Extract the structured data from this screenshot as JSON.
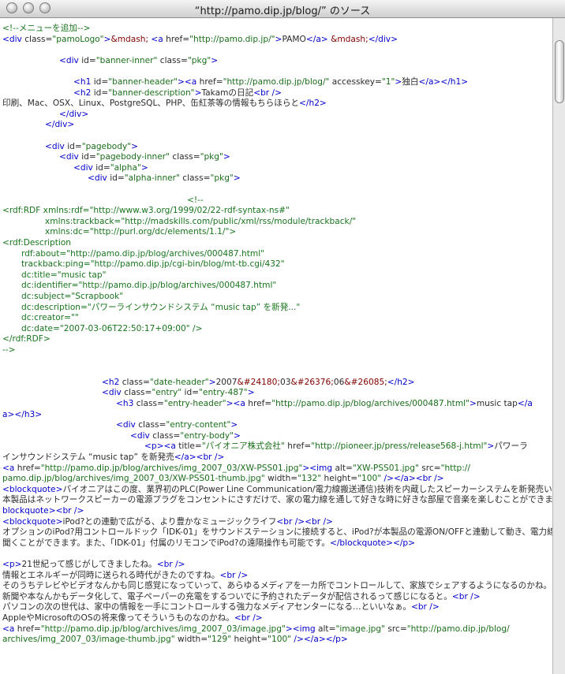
{
  "window": {
    "title": "“http://pamo.dip.jp/blog/” のソース"
  },
  "source": [
    {
      "indent": 0,
      "segs": [
        [
          "cmt",
          "<!--メニューを追加-->"
        ]
      ]
    },
    {
      "indent": 0,
      "segs": [
        [
          "tag",
          "<div "
        ],
        [
          "attr",
          "class="
        ],
        [
          "val",
          "\"pamoLogo\""
        ],
        [
          "tag",
          ">"
        ],
        [
          "ent",
          "&mdash;"
        ],
        [
          "attr",
          " "
        ],
        [
          "tag",
          "<a "
        ],
        [
          "attr",
          "href="
        ],
        [
          "val",
          "\"http://pamo.dip.jp/\""
        ],
        [
          "tag",
          ">"
        ],
        [
          "attr",
          "PAMO"
        ],
        [
          "tag",
          "</a>"
        ],
        [
          "attr",
          " "
        ],
        [
          "ent",
          "&mdash;"
        ],
        [
          "tag",
          "</div>"
        ]
      ]
    },
    {
      "indent": 0,
      "segs": []
    },
    {
      "indent": 72,
      "segs": [
        [
          "tag",
          "<div "
        ],
        [
          "attr",
          "id="
        ],
        [
          "val",
          "\"banner-inner\""
        ],
        [
          "attr",
          " class="
        ],
        [
          "val",
          "\"pkg\""
        ],
        [
          "tag",
          ">"
        ]
      ]
    },
    {
      "indent": 0,
      "segs": []
    },
    {
      "indent": 90,
      "segs": [
        [
          "tag",
          "<h1 "
        ],
        [
          "attr",
          "id="
        ],
        [
          "val",
          "\"banner-header\""
        ],
        [
          "tag",
          "><a "
        ],
        [
          "attr",
          "href="
        ],
        [
          "val",
          "\"http://pamo.dip.jp/blog/\""
        ],
        [
          "attr",
          " accesskey="
        ],
        [
          "val",
          "\"1\""
        ],
        [
          "tag",
          ">"
        ],
        [
          "attr",
          "独白"
        ],
        [
          "tag",
          "</a></h1>"
        ]
      ]
    },
    {
      "indent": 90,
      "segs": [
        [
          "tag",
          "<h2 "
        ],
        [
          "attr",
          "id="
        ],
        [
          "val",
          "\"banner-description\""
        ],
        [
          "tag",
          ">"
        ],
        [
          "attr",
          "Takamの日記"
        ],
        [
          "tag",
          "<br />"
        ]
      ]
    },
    {
      "indent": 0,
      "segs": [
        [
          "attr",
          "印刷、Mac、OSX、Linux、PostgreSQL、PHP、缶紅茶等の情報もちらほらと"
        ],
        [
          "tag",
          "</h2>"
        ]
      ]
    },
    {
      "indent": 72,
      "segs": [
        [
          "tag",
          "</div>"
        ]
      ]
    },
    {
      "indent": 54,
      "segs": [
        [
          "tag",
          "</div>"
        ]
      ]
    },
    {
      "indent": 0,
      "segs": []
    },
    {
      "indent": 54,
      "segs": [
        [
          "tag",
          "<div "
        ],
        [
          "attr",
          "id="
        ],
        [
          "val",
          "\"pagebody\""
        ],
        [
          "tag",
          ">"
        ]
      ]
    },
    {
      "indent": 72,
      "segs": [
        [
          "tag",
          "<div "
        ],
        [
          "attr",
          "id="
        ],
        [
          "val",
          "\"pagebody-inner\""
        ],
        [
          "attr",
          " class="
        ],
        [
          "val",
          "\"pkg\""
        ],
        [
          "tag",
          ">"
        ]
      ]
    },
    {
      "indent": 90,
      "segs": [
        [
          "tag",
          "<div "
        ],
        [
          "attr",
          "id="
        ],
        [
          "val",
          "\"alpha\""
        ],
        [
          "tag",
          ">"
        ]
      ]
    },
    {
      "indent": 108,
      "segs": [
        [
          "tag",
          "<div "
        ],
        [
          "attr",
          "id="
        ],
        [
          "val",
          "\"alpha-inner\""
        ],
        [
          "attr",
          " class="
        ],
        [
          "val",
          "\"pkg\""
        ],
        [
          "tag",
          ">"
        ]
      ]
    },
    {
      "indent": 0,
      "segs": []
    },
    {
      "indent": 234,
      "segs": [
        [
          "cmt",
          "<!--"
        ]
      ]
    },
    {
      "indent": 0,
      "segs": [
        [
          "cmt",
          "<rdf:RDF xmlns:rdf=\"http://www.w3.org/1999/02/22-rdf-syntax-ns#\""
        ]
      ]
    },
    {
      "indent": 54,
      "segs": [
        [
          "cmt",
          "xmlns:trackback=\"http://madskills.com/public/xml/rss/module/trackback/\""
        ]
      ]
    },
    {
      "indent": 54,
      "segs": [
        [
          "cmt",
          "xmlns:dc=\"http://purl.org/dc/elements/1.1/\">"
        ]
      ]
    },
    {
      "indent": 0,
      "segs": [
        [
          "cmt",
          "<rdf:Description"
        ]
      ]
    },
    {
      "indent": 24,
      "segs": [
        [
          "cmt",
          "rdf:about=\"http://pamo.dip.jp/blog/archives/000487.html\""
        ]
      ]
    },
    {
      "indent": 24,
      "segs": [
        [
          "cmt",
          "trackback:ping=\"http://pamo.dip.jp/cgi-bin/blog/mt-tb.cgi/432\""
        ]
      ]
    },
    {
      "indent": 24,
      "segs": [
        [
          "cmt",
          "dc:title=\"music tap\""
        ]
      ]
    },
    {
      "indent": 24,
      "segs": [
        [
          "cmt",
          "dc:identifier=\"http://pamo.dip.jp/blog/archives/000487.html\""
        ]
      ]
    },
    {
      "indent": 24,
      "segs": [
        [
          "cmt",
          "dc:subject=\"Scrapbook\""
        ]
      ]
    },
    {
      "indent": 24,
      "segs": [
        [
          "cmt",
          "dc:description=\"パワーラインサウンドシステム “music tap” を新発...\""
        ]
      ]
    },
    {
      "indent": 24,
      "segs": [
        [
          "cmt",
          "dc:creator=\"\""
        ]
      ]
    },
    {
      "indent": 24,
      "segs": [
        [
          "cmt",
          "dc:date=\"2007-03-06T22:50:17+09:00\" />"
        ]
      ]
    },
    {
      "indent": 0,
      "segs": [
        [
          "cmt",
          "</rdf:RDF>"
        ]
      ]
    },
    {
      "indent": 0,
      "segs": [
        [
          "cmt",
          "-->"
        ]
      ]
    },
    {
      "indent": 0,
      "segs": []
    },
    {
      "indent": 0,
      "segs": []
    },
    {
      "indent": 126,
      "segs": [
        [
          "tag",
          "<h2 "
        ],
        [
          "attr",
          "class="
        ],
        [
          "val",
          "\"date-header\""
        ],
        [
          "tag",
          ">"
        ],
        [
          "attr",
          "2007"
        ],
        [
          "ent",
          "&#24180;"
        ],
        [
          "attr",
          "03"
        ],
        [
          "ent",
          "&#26376;"
        ],
        [
          "attr",
          "06"
        ],
        [
          "ent",
          "&#26085;"
        ],
        [
          "tag",
          "</h2>"
        ]
      ]
    },
    {
      "indent": 126,
      "segs": [
        [
          "tag",
          "<div "
        ],
        [
          "attr",
          "class="
        ],
        [
          "val",
          "\"entry\""
        ],
        [
          "attr",
          " id="
        ],
        [
          "val",
          "\"entry-487\""
        ],
        [
          "tag",
          ">"
        ]
      ]
    },
    {
      "indent": 144,
      "segs": [
        [
          "tag",
          "<h3 "
        ],
        [
          "attr",
          "class="
        ],
        [
          "val",
          "\"entry-header\""
        ],
        [
          "tag",
          "><a "
        ],
        [
          "attr",
          "href="
        ],
        [
          "val",
          "\"http://pamo.dip.jp/blog/archives/000487.html\""
        ],
        [
          "tag",
          ">"
        ],
        [
          "attr",
          "music tap"
        ],
        [
          "tag",
          "</a"
        ]
      ]
    },
    {
      "indent": 0,
      "segs": [
        [
          "tag",
          "a></h3>"
        ]
      ]
    },
    {
      "indent": 144,
      "segs": [
        [
          "tag",
          "<div "
        ],
        [
          "attr",
          "class="
        ],
        [
          "val",
          "\"entry-content\""
        ],
        [
          "tag",
          ">"
        ]
      ]
    },
    {
      "indent": 162,
      "segs": [
        [
          "tag",
          "<div "
        ],
        [
          "attr",
          "class="
        ],
        [
          "val",
          "\"entry-body\""
        ],
        [
          "tag",
          ">"
        ]
      ]
    },
    {
      "indent": 180,
      "segs": [
        [
          "tag",
          "<p><a "
        ],
        [
          "attr",
          "title="
        ],
        [
          "val",
          "\"パイオニア株式会社\""
        ],
        [
          "attr",
          " href="
        ],
        [
          "val",
          "\"http://pioneer.jp/press/release568-j.html\""
        ],
        [
          "tag",
          ">"
        ],
        [
          "attr",
          "パワーラ"
        ]
      ]
    },
    {
      "indent": 0,
      "segs": [
        [
          "attr",
          "インサウンドシステム “music tap” を新発売"
        ],
        [
          "tag",
          "</a><br />"
        ]
      ]
    },
    {
      "indent": 0,
      "segs": [
        [
          "tag",
          "<a "
        ],
        [
          "attr",
          "href="
        ],
        [
          "val",
          "\"http://pamo.dip.jp/blog/archives/img_2007_03/XW-PSS01.jpg\""
        ],
        [
          "tag",
          "><img "
        ],
        [
          "attr",
          "alt="
        ],
        [
          "val",
          "\"XW-PSS01.jpg\""
        ],
        [
          "attr",
          " src="
        ],
        [
          "val",
          "\"http://"
        ]
      ]
    },
    {
      "indent": 0,
      "segs": [
        [
          "val",
          "pamo.dip.jp/blog/archives/img_2007_03/XW-PSS01-thumb.jpg\""
        ],
        [
          "attr",
          " width="
        ],
        [
          "val",
          "\"132\""
        ],
        [
          "attr",
          " height="
        ],
        [
          "val",
          "\"100\""
        ],
        [
          "tag",
          " /></a><br />"
        ]
      ]
    },
    {
      "indent": 0,
      "segs": [
        [
          "tag",
          "<blockquote>"
        ],
        [
          "attr",
          "パイオニアはこの度、業界初のPLC(Power Line Communication/電力線搬送通信)技術を内蔵したスピーカーシステムを新発売いたします。"
        ]
      ]
    },
    {
      "indent": 0,
      "segs": [
        [
          "attr",
          "本製品はネットワークスピーカーの電源プラグをコンセントにさすだけで、家の電力線を通して好きな時に好きな部屋で音楽を楽しむことができます。"
        ],
        [
          "tag",
          "</"
        ]
      ]
    },
    {
      "indent": 0,
      "segs": [
        [
          "tag",
          "blockquote><br />"
        ]
      ]
    },
    {
      "indent": 0,
      "segs": [
        [
          "tag",
          "<blockquote>"
        ],
        [
          "attr",
          "iPod?との連動で広がる、より豊かなミュージックライフ"
        ],
        [
          "tag",
          "<br /><br />"
        ]
      ]
    },
    {
      "indent": 0,
      "segs": [
        [
          "attr",
          "オプションのiPod?用コントロールドック「IDK-01」をサウンドステーションに接続すると、iPod?が本製品の電源ON/OFFと連動して動き、電力線を介して家中どこでも"
        ]
      ]
    },
    {
      "indent": 0,
      "segs": [
        [
          "attr",
          "聞くことができます。また、「IDK-01」付属のリモコンでiPod?の遠隔操作も可能です。"
        ],
        [
          "tag",
          "</blockquote></p>"
        ]
      ]
    },
    {
      "indent": 0,
      "segs": []
    },
    {
      "indent": 0,
      "segs": [
        [
          "tag",
          "<p>"
        ],
        [
          "attr",
          "21世紀って感じがしてきましたね。"
        ],
        [
          "tag",
          "<br />"
        ]
      ]
    },
    {
      "indent": 0,
      "segs": [
        [
          "attr",
          "情報とエネルギーが同時に送られる時代がきたのですね。"
        ],
        [
          "tag",
          "<br />"
        ]
      ]
    },
    {
      "indent": 0,
      "segs": [
        [
          "attr",
          "そのうちテレビやビデオなんかも同じ感覚になっていって、あらゆるメディアを一カ所でコントロールして、家族でシェアするようになるのかね。"
        ],
        [
          "tag",
          "<br />"
        ]
      ]
    },
    {
      "indent": 0,
      "segs": [
        [
          "attr",
          "新聞や本なんかもデータ化して、電子ペーパーの充電をするついでに予約されたデータが配信されるって感じになると。"
        ],
        [
          "tag",
          "<br />"
        ]
      ]
    },
    {
      "indent": 0,
      "segs": [
        [
          "attr",
          "パソコンの次の世代は、家中の情報を一手にコントロールする強力なメディアセンターになる…といいなぁ。"
        ],
        [
          "tag",
          "<br />"
        ]
      ]
    },
    {
      "indent": 0,
      "segs": [
        [
          "attr",
          "AppleやMicrosoftのOSの将来像ってそういうものなのかね。"
        ],
        [
          "tag",
          "<br />"
        ]
      ]
    },
    {
      "indent": 0,
      "segs": [
        [
          "tag",
          "<a "
        ],
        [
          "attr",
          "href="
        ],
        [
          "val",
          "\"http://pamo.dip.jp/blog/archives/img_2007_03/image.jpg\""
        ],
        [
          "tag",
          "><img "
        ],
        [
          "attr",
          "alt="
        ],
        [
          "val",
          "\"image.jpg\""
        ],
        [
          "attr",
          " src="
        ],
        [
          "val",
          "\"http://pamo.dip.jp/blog/"
        ]
      ]
    },
    {
      "indent": 0,
      "segs": [
        [
          "val",
          "archives/img_2007_03/image-thumb.jpg\""
        ],
        [
          "attr",
          " width="
        ],
        [
          "val",
          "\"129\""
        ],
        [
          "attr",
          " height="
        ],
        [
          "val",
          "\"100\""
        ],
        [
          "tag",
          " /></a></p>"
        ]
      ]
    }
  ]
}
